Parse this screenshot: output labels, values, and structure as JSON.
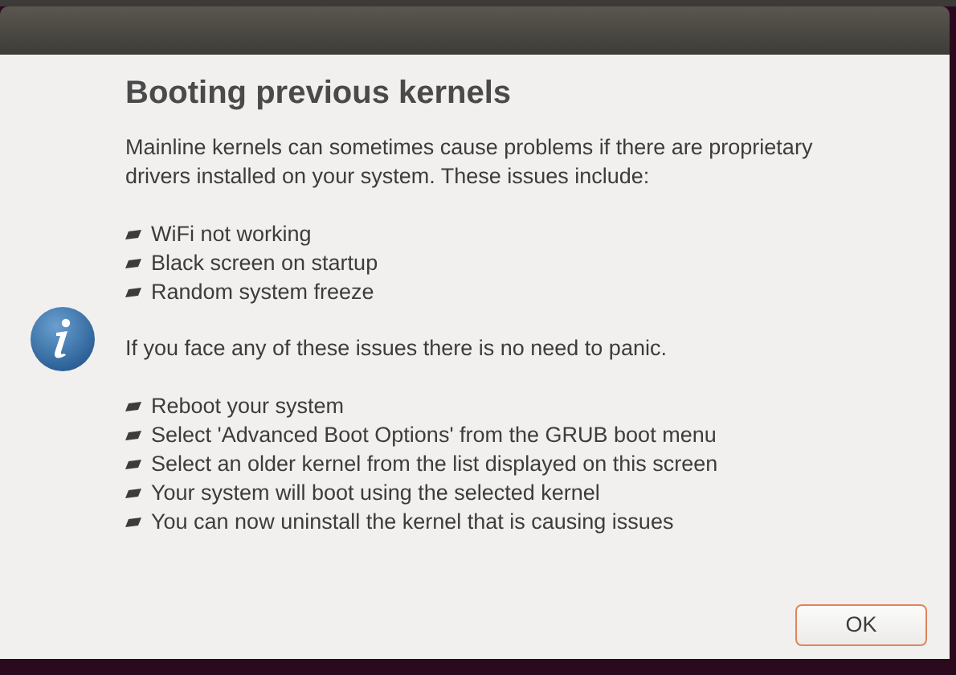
{
  "dialog": {
    "heading": "Booting previous kernels",
    "intro": "Mainline kernels can sometimes cause problems if there are proprietary drivers installed on your system. These issues include:",
    "issues": [
      "WiFi not working",
      "Black screen on startup",
      "Random system freeze"
    ],
    "advice": "If you face any of these issues there is no need to panic.",
    "steps": [
      "Reboot your system",
      "Select 'Advanced Boot Options' from the GRUB boot menu",
      "Select an older kernel from the list displayed on this screen",
      "Your system will boot using the selected kernel",
      "You can now uninstall the kernel that is causing issues"
    ],
    "buttons": [
      "OK"
    ]
  }
}
